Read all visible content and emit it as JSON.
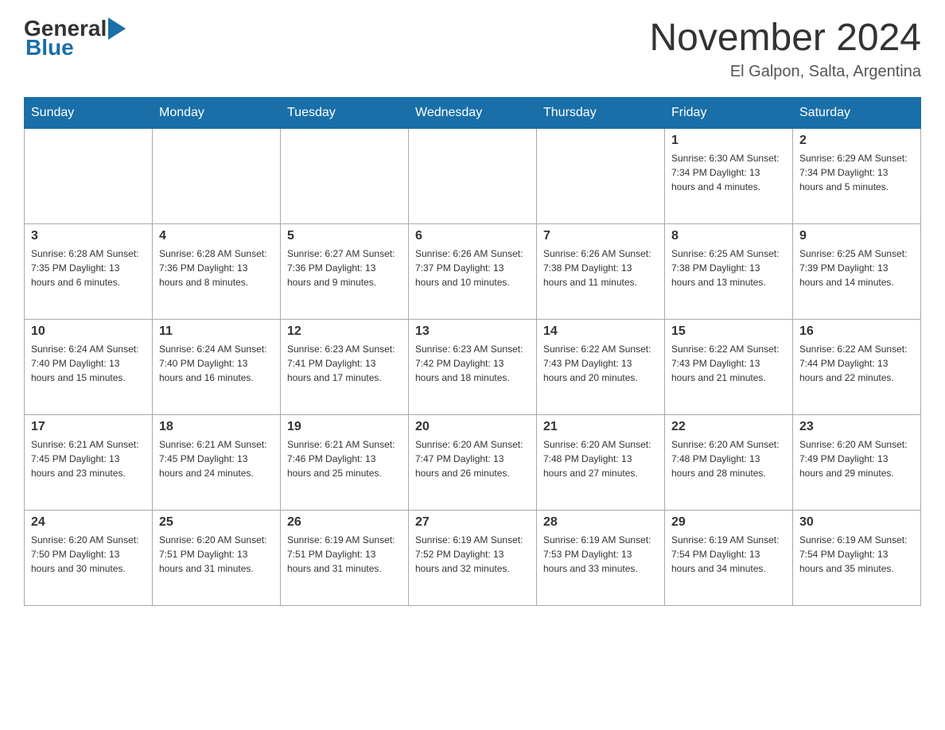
{
  "header": {
    "logo": {
      "general": "General",
      "blue": "Blue"
    },
    "title": "November 2024",
    "location": "El Galpon, Salta, Argentina"
  },
  "days_of_week": [
    "Sunday",
    "Monday",
    "Tuesday",
    "Wednesday",
    "Thursday",
    "Friday",
    "Saturday"
  ],
  "weeks": [
    [
      {
        "day": "",
        "info": ""
      },
      {
        "day": "",
        "info": ""
      },
      {
        "day": "",
        "info": ""
      },
      {
        "day": "",
        "info": ""
      },
      {
        "day": "",
        "info": ""
      },
      {
        "day": "1",
        "info": "Sunrise: 6:30 AM\nSunset: 7:34 PM\nDaylight: 13 hours and 4 minutes."
      },
      {
        "day": "2",
        "info": "Sunrise: 6:29 AM\nSunset: 7:34 PM\nDaylight: 13 hours and 5 minutes."
      }
    ],
    [
      {
        "day": "3",
        "info": "Sunrise: 6:28 AM\nSunset: 7:35 PM\nDaylight: 13 hours and 6 minutes."
      },
      {
        "day": "4",
        "info": "Sunrise: 6:28 AM\nSunset: 7:36 PM\nDaylight: 13 hours and 8 minutes."
      },
      {
        "day": "5",
        "info": "Sunrise: 6:27 AM\nSunset: 7:36 PM\nDaylight: 13 hours and 9 minutes."
      },
      {
        "day": "6",
        "info": "Sunrise: 6:26 AM\nSunset: 7:37 PM\nDaylight: 13 hours and 10 minutes."
      },
      {
        "day": "7",
        "info": "Sunrise: 6:26 AM\nSunset: 7:38 PM\nDaylight: 13 hours and 11 minutes."
      },
      {
        "day": "8",
        "info": "Sunrise: 6:25 AM\nSunset: 7:38 PM\nDaylight: 13 hours and 13 minutes."
      },
      {
        "day": "9",
        "info": "Sunrise: 6:25 AM\nSunset: 7:39 PM\nDaylight: 13 hours and 14 minutes."
      }
    ],
    [
      {
        "day": "10",
        "info": "Sunrise: 6:24 AM\nSunset: 7:40 PM\nDaylight: 13 hours and 15 minutes."
      },
      {
        "day": "11",
        "info": "Sunrise: 6:24 AM\nSunset: 7:40 PM\nDaylight: 13 hours and 16 minutes."
      },
      {
        "day": "12",
        "info": "Sunrise: 6:23 AM\nSunset: 7:41 PM\nDaylight: 13 hours and 17 minutes."
      },
      {
        "day": "13",
        "info": "Sunrise: 6:23 AM\nSunset: 7:42 PM\nDaylight: 13 hours and 18 minutes."
      },
      {
        "day": "14",
        "info": "Sunrise: 6:22 AM\nSunset: 7:43 PM\nDaylight: 13 hours and 20 minutes."
      },
      {
        "day": "15",
        "info": "Sunrise: 6:22 AM\nSunset: 7:43 PM\nDaylight: 13 hours and 21 minutes."
      },
      {
        "day": "16",
        "info": "Sunrise: 6:22 AM\nSunset: 7:44 PM\nDaylight: 13 hours and 22 minutes."
      }
    ],
    [
      {
        "day": "17",
        "info": "Sunrise: 6:21 AM\nSunset: 7:45 PM\nDaylight: 13 hours and 23 minutes."
      },
      {
        "day": "18",
        "info": "Sunrise: 6:21 AM\nSunset: 7:45 PM\nDaylight: 13 hours and 24 minutes."
      },
      {
        "day": "19",
        "info": "Sunrise: 6:21 AM\nSunset: 7:46 PM\nDaylight: 13 hours and 25 minutes."
      },
      {
        "day": "20",
        "info": "Sunrise: 6:20 AM\nSunset: 7:47 PM\nDaylight: 13 hours and 26 minutes."
      },
      {
        "day": "21",
        "info": "Sunrise: 6:20 AM\nSunset: 7:48 PM\nDaylight: 13 hours and 27 minutes."
      },
      {
        "day": "22",
        "info": "Sunrise: 6:20 AM\nSunset: 7:48 PM\nDaylight: 13 hours and 28 minutes."
      },
      {
        "day": "23",
        "info": "Sunrise: 6:20 AM\nSunset: 7:49 PM\nDaylight: 13 hours and 29 minutes."
      }
    ],
    [
      {
        "day": "24",
        "info": "Sunrise: 6:20 AM\nSunset: 7:50 PM\nDaylight: 13 hours and 30 minutes."
      },
      {
        "day": "25",
        "info": "Sunrise: 6:20 AM\nSunset: 7:51 PM\nDaylight: 13 hours and 31 minutes."
      },
      {
        "day": "26",
        "info": "Sunrise: 6:19 AM\nSunset: 7:51 PM\nDaylight: 13 hours and 31 minutes."
      },
      {
        "day": "27",
        "info": "Sunrise: 6:19 AM\nSunset: 7:52 PM\nDaylight: 13 hours and 32 minutes."
      },
      {
        "day": "28",
        "info": "Sunrise: 6:19 AM\nSunset: 7:53 PM\nDaylight: 13 hours and 33 minutes."
      },
      {
        "day": "29",
        "info": "Sunrise: 6:19 AM\nSunset: 7:54 PM\nDaylight: 13 hours and 34 minutes."
      },
      {
        "day": "30",
        "info": "Sunrise: 6:19 AM\nSunset: 7:54 PM\nDaylight: 13 hours and 35 minutes."
      }
    ]
  ]
}
